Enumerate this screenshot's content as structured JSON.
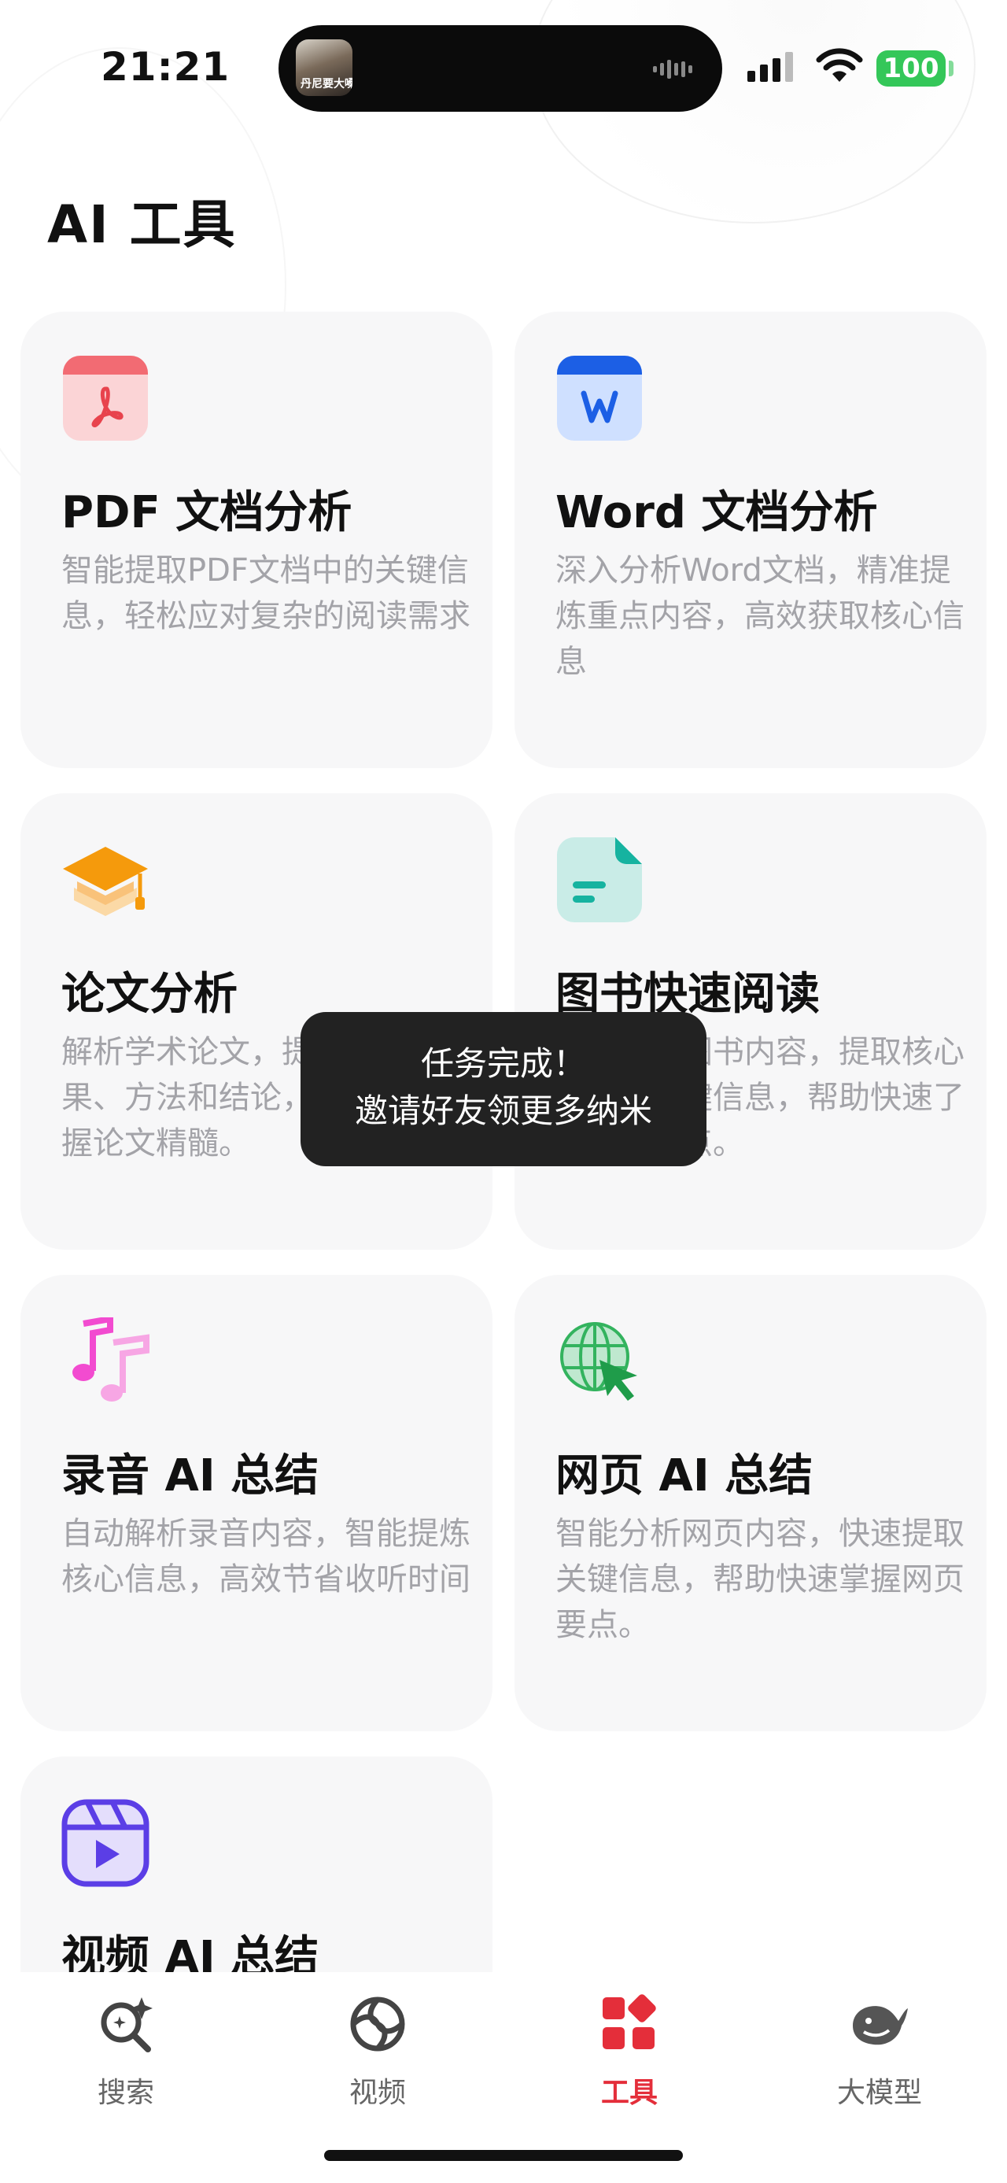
{
  "status_bar": {
    "time": "21:21",
    "island_thumb_text": "丹尼要大嗓门超鲜艳",
    "battery": "100",
    "colors": {
      "battery": "#34c759"
    }
  },
  "page": {
    "title": "AI 工具"
  },
  "tools": [
    {
      "icon": "pdf-icon",
      "title": "PDF 文档分析",
      "desc": "智能提取PDF文档中的关键信息，轻松应对复杂的阅读需求"
    },
    {
      "icon": "word-icon",
      "title": "Word 文档分析",
      "desc": "深入分析Word文档，精准提炼重点内容，高效获取核心信息"
    },
    {
      "icon": "graduation-cap-icon",
      "title": "论文分析",
      "desc": "解析学术论文，提取研究成果、方法和结论，帮助快速掌握论文精髓。"
    },
    {
      "icon": "document-icon",
      "title": "图书快速阅读",
      "desc": "快速解析图书内容，提取核心思想和关键信息，帮助快速了解书籍要点。"
    },
    {
      "icon": "music-notes-icon",
      "title": "录音 AI 总结",
      "desc": "自动解析录音内容，智能提炼核心信息，高效节省收听时间"
    },
    {
      "icon": "globe-cursor-icon",
      "title": "网页 AI 总结",
      "desc": "智能分析网页内容，快速提取关键信息，帮助快速掌握网页要点。"
    },
    {
      "icon": "video-clapper-icon",
      "title": "视频 AI 总结",
      "desc": ""
    }
  ],
  "toast": {
    "line1": "任务完成！",
    "line2": "邀请好友领更多纳米"
  },
  "tabbar": {
    "items": [
      {
        "label": "搜索",
        "icon": "search-sparkle-icon"
      },
      {
        "label": "视频",
        "icon": "video-aperture-icon"
      },
      {
        "label": "工具",
        "icon": "tools-grid-icon",
        "active": true
      },
      {
        "label": "大模型",
        "icon": "whale-icon"
      }
    ],
    "colors": {
      "active": "#e42e3a"
    }
  }
}
